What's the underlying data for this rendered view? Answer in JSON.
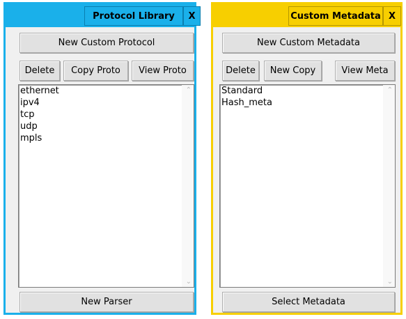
{
  "protocol_panel": {
    "title": "Protocol Library",
    "close_label": "X",
    "new_button": "New Custom Protocol",
    "delete_button": "Delete",
    "copy_button": "Copy Proto",
    "view_button": "View Proto",
    "items": [
      "ethernet",
      "ipv4",
      "tcp",
      "udp",
      "mpls"
    ],
    "bottom_button": "New Parser",
    "accent": "#1ab0ea"
  },
  "metadata_panel": {
    "title": "Custom Metadata",
    "close_label": "X",
    "new_button": "New Custom Metadata",
    "delete_button": "Delete",
    "copy_button": "New Copy",
    "view_button": "View Meta",
    "items": [
      "Standard",
      "Hash_meta"
    ],
    "bottom_button": "Select Metadata",
    "accent": "#f7cf00"
  },
  "icons": {
    "scroll_up": "chevron-up-icon",
    "scroll_down": "chevron-down-icon"
  }
}
